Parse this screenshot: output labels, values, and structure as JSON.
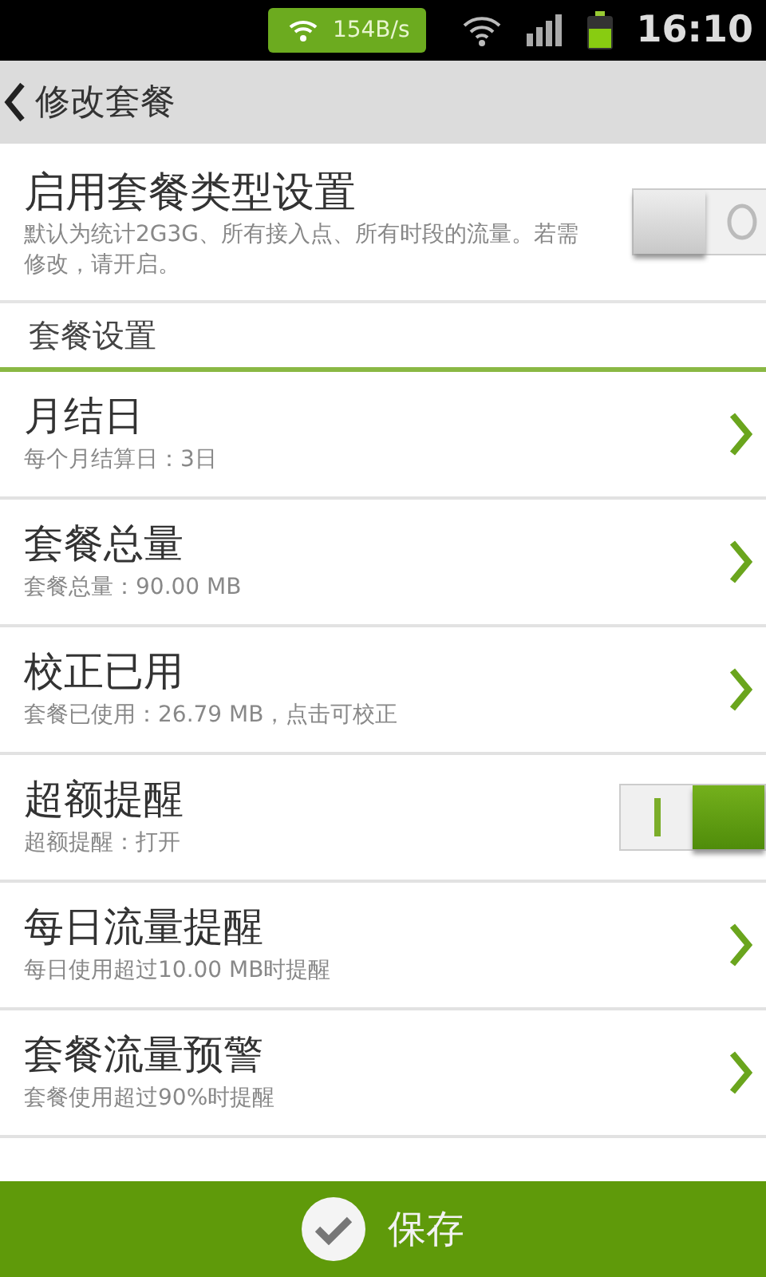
{
  "status_bar": {
    "speed": "154B/s",
    "time": "16:10"
  },
  "header": {
    "title": "修改套餐"
  },
  "main_toggle": {
    "title": "启用套餐类型设置",
    "description": "默认为统计2G3G、所有接入点、所有时段的流量。若需修改，请开启。",
    "on": false
  },
  "section": {
    "title": "套餐设置"
  },
  "rows": [
    {
      "kind": "link",
      "title": "月结日",
      "subtitle": "每个月结算日：3日"
    },
    {
      "kind": "link",
      "title": "套餐总量",
      "subtitle": "套餐总量：90.00 MB"
    },
    {
      "kind": "link",
      "title": "校正已用",
      "subtitle": "套餐已使用：26.79 MB，点击可校正"
    },
    {
      "kind": "toggle",
      "title": "超额提醒",
      "subtitle": "超额提醒：打开",
      "on": true
    },
    {
      "kind": "link",
      "title": "每日流量提醒",
      "subtitle": "每日使用超过10.00 MB时提醒"
    },
    {
      "kind": "link",
      "title": "套餐流量预警",
      "subtitle": "套餐使用超过90%时提醒"
    }
  ],
  "save_button": {
    "label": "保存"
  }
}
